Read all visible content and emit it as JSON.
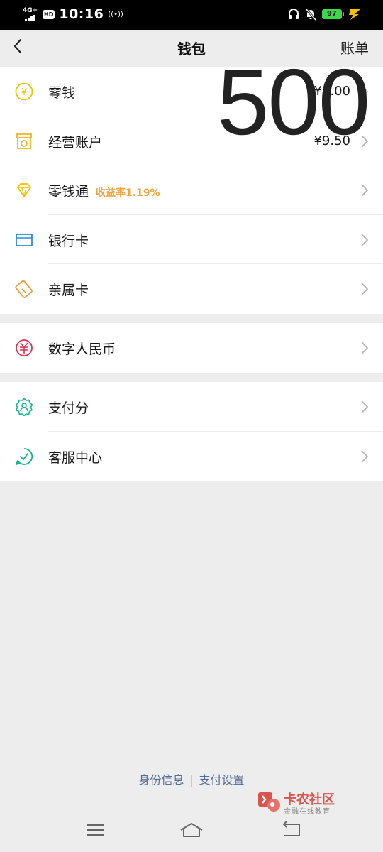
{
  "status_bar": {
    "network": "4G+",
    "hd_badge": "HD",
    "time": "10:16",
    "hotspot": "((•))",
    "battery": "97"
  },
  "nav": {
    "title": "钱包",
    "right_label": "账单"
  },
  "overlay_text": "500",
  "groups": [
    {
      "items": [
        {
          "label": "零钱",
          "value": "¥0.00",
          "icon": "yuan-coin-icon",
          "color": "#f2c200"
        },
        {
          "label": "经营账户",
          "value": "¥9.50",
          "icon": "shop-account-icon",
          "color": "#f2b21b"
        },
        {
          "label": "零钱通",
          "tag": "收益率1.19%",
          "icon": "diamond-icon",
          "color": "#f2c200"
        },
        {
          "label": "银行卡",
          "icon": "bank-card-icon",
          "color": "#2a8dd8"
        },
        {
          "label": "亲属卡",
          "icon": "family-card-icon",
          "color": "#f29a3a"
        }
      ]
    },
    {
      "items": [
        {
          "label": "数字人民币",
          "icon": "digital-rmb-icon",
          "color": "#e0304c"
        }
      ]
    },
    {
      "items": [
        {
          "label": "支付分",
          "icon": "pay-score-icon",
          "color": "#12b38a"
        },
        {
          "label": "客服中心",
          "icon": "customer-service-icon",
          "color": "#12b38a"
        }
      ]
    }
  ],
  "footer": {
    "identity_link": "身份信息",
    "settings_link": "支付设置"
  },
  "watermark": {
    "title": "卡农社区",
    "subtitle": "金融在线教育"
  }
}
